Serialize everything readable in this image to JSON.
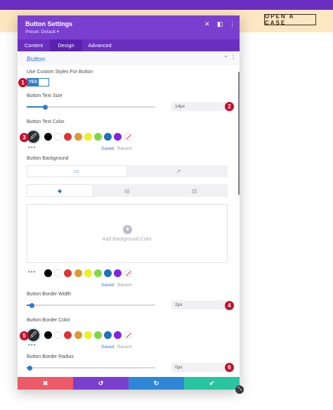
{
  "site": {
    "case_button": "OPEN A CASE"
  },
  "modal": {
    "title": "Button Settings",
    "preset": "Preset: Default ▾",
    "icons": {
      "close": "✕",
      "dock": "◧",
      "more": "⋮"
    },
    "tabs": [
      {
        "label": "Content"
      },
      {
        "label": "Design"
      },
      {
        "label": "Advanced"
      }
    ],
    "active_tab": "Design",
    "section": {
      "title": "Button",
      "collapse_icon": "⌃",
      "more_icon": "⋮"
    }
  },
  "fields": {
    "custom_styles": {
      "label": "Use Custom Styles For Button",
      "toggle": "YES"
    },
    "text_size": {
      "label": "Button Text Size",
      "value": "14px",
      "slider_fraction": 0.14
    },
    "text_color": {
      "label": "Button Text Color"
    },
    "background": {
      "label": "Button Background",
      "add_label": "Add Background Color",
      "plus": "+"
    },
    "border_width": {
      "label": "Button Border Width",
      "value": "2px",
      "slider_fraction": 0.04
    },
    "border_color": {
      "label": "Button Border Color"
    },
    "border_radius": {
      "label": "Button Border Radius",
      "value": "0px",
      "slider_fraction": 0.02
    }
  },
  "palette": {
    "colors": [
      "#000000",
      "#ffffff",
      "#dd3333",
      "#dd9933",
      "#eeee22",
      "#81d742",
      "#1e73be",
      "#8224e3"
    ],
    "saved": "Saved",
    "recent": "Recent",
    "more": "•••",
    "picker_icon": "🖉"
  },
  "badges": [
    "1",
    "2",
    "3",
    "4",
    "5",
    "6"
  ],
  "footer": {
    "cancel": "✖",
    "undo": "↺",
    "redo": "↻",
    "save": "✔",
    "colors": {
      "cancel": "#ef5a6a",
      "undo": "#7b3fd0",
      "redo": "#2e86d6",
      "save": "#29c4a0"
    }
  },
  "resize_icon": "⤡"
}
